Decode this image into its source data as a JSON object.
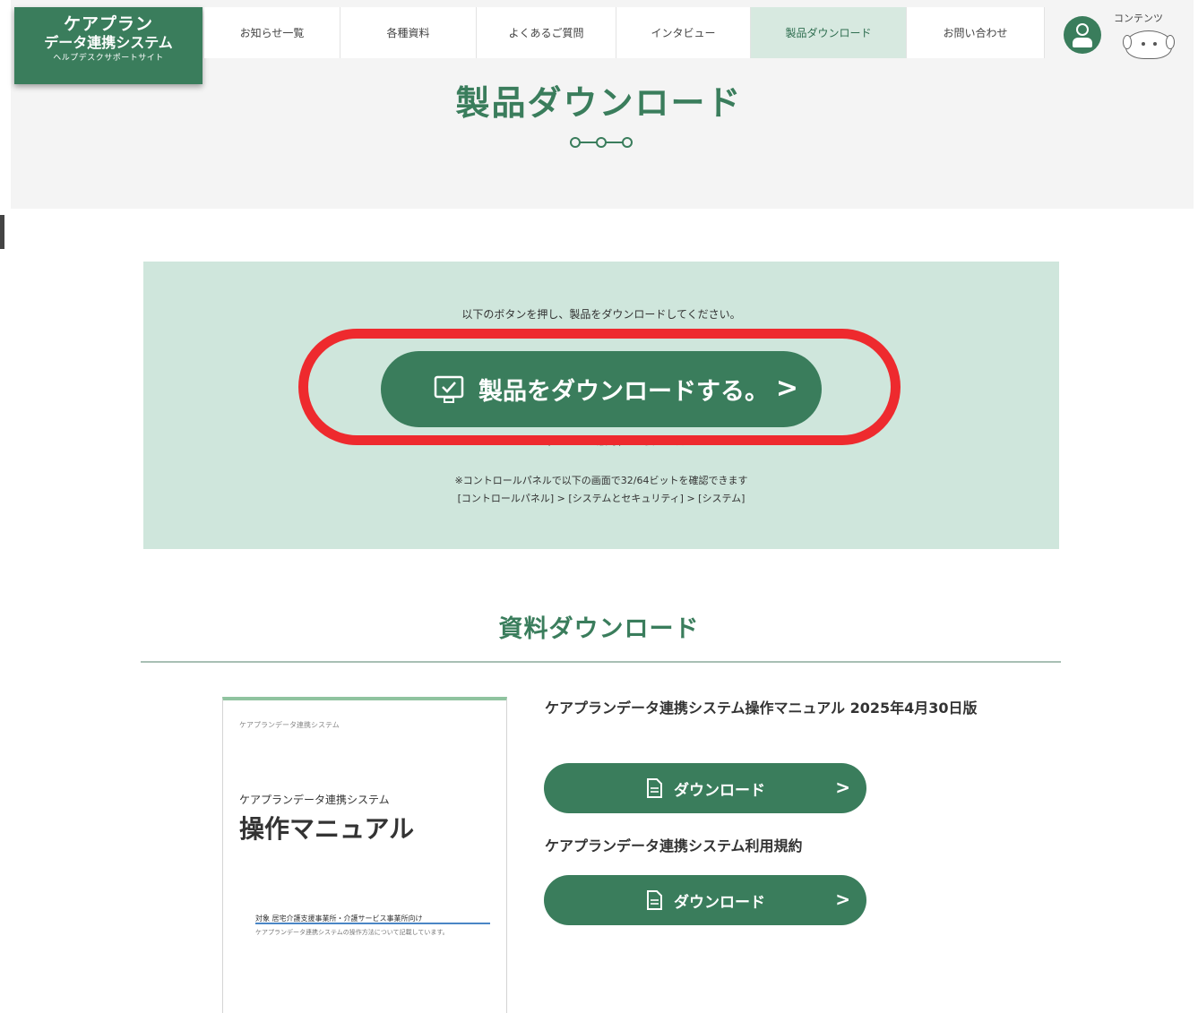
{
  "logo": {
    "line1": "ケアプラン",
    "line2": "データ連携システム",
    "line3": "ヘルプデスクサポートサイト"
  },
  "nav": {
    "items": [
      {
        "label": "お知らせ一覧"
      },
      {
        "label": "各種資料"
      },
      {
        "label": "よくあるご質問"
      },
      {
        "label": "インタビュー"
      },
      {
        "label": "製品ダウンロード"
      },
      {
        "label": "お問い合わせ"
      }
    ],
    "active_index": 4,
    "mascot_label": "コンテンツ"
  },
  "page": {
    "title": "製品ダウンロード"
  },
  "download_panel": {
    "instruction": "以下のボタンを押し、製品をダウンロードしてください。",
    "button_label": "製品をダウンロードする。",
    "chevron": ">",
    "win10_link": "> Windows10(32ビット版等)をお使いの方はこちら",
    "note_line1": "※コントロールパネルで以下の画面で32/64ビットを確認できます",
    "note_line2": "[コントロールパネル] > [システムとセキュリティ] > [システム]",
    "highlight_color": "#ee2a2e"
  },
  "materials": {
    "section_title": "資料ダウンロード",
    "preview": {
      "small_text": "ケアプランデータ連携システム",
      "subtitle": "ケアプランデータ連携システム",
      "title": "操作マニュアル",
      "footer_line1": "対象 居宅介護支援事業所・介護サービス事業所向け",
      "footer_line2": "ケアプランデータ連携システムの操作方法について記載しています。"
    },
    "items": [
      {
        "title": "ケアプランデータ連携システム操作マニュアル 2025年4月30日版",
        "button_label": "ダウンロード"
      },
      {
        "title": "ケアプランデータ連携システム利用規約",
        "button_label": "ダウンロード"
      }
    ],
    "button_chevron": ">"
  },
  "colors": {
    "brand_green": "#3a7d5c",
    "panel_mint": "#cfe6dc",
    "active_nav": "#d7e9e0"
  },
  "icons": {
    "monitor": "monitor-check-icon",
    "document": "document-icon",
    "user": "user-icon",
    "mascot": "dog-mascot-icon"
  }
}
